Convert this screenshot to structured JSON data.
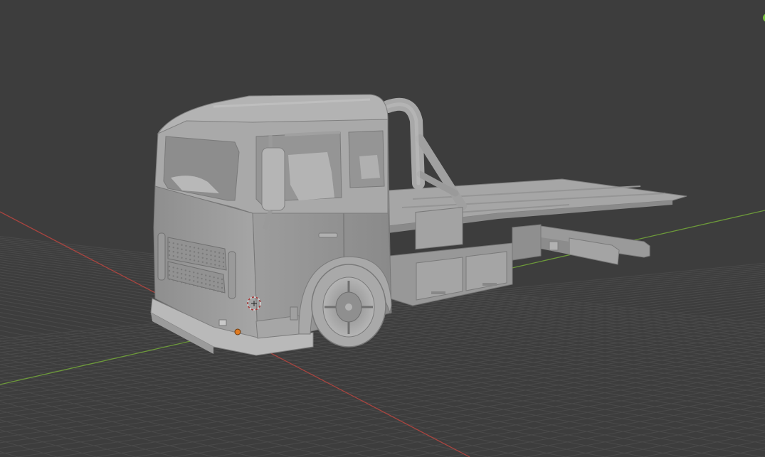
{
  "viewport": {
    "background": "#3d3d3d",
    "grid_color": "#4a4a4a",
    "x_axis_color": "#a8443f",
    "y_axis_color": "#6d9a3a",
    "model_color": "#a3a3a3",
    "model_shadow": "#7c7c7c",
    "model_highlight": "#c4c4c4",
    "origin_color": "#e07a20",
    "gizmo_dot_color": "#79c23e"
  },
  "scene": {
    "object": "flatbed-tow-truck",
    "shading": "solid",
    "selected_object_origin": true
  }
}
